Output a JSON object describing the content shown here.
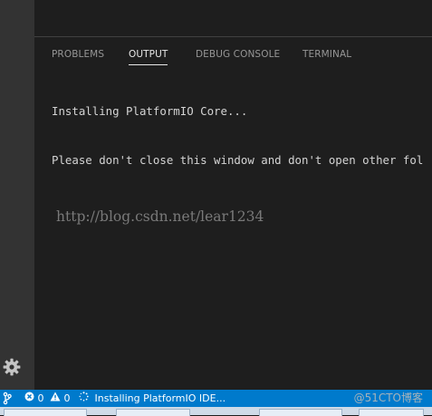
{
  "panel": {
    "tabs": [
      {
        "label": "PROBLEMS"
      },
      {
        "label": "OUTPUT"
      },
      {
        "label": "DEBUG CONSOLE"
      },
      {
        "label": "TERMINAL"
      }
    ],
    "active_tab": "OUTPUT",
    "output_lines": [
      "Installing PlatformIO Core...",
      "Please don't close this window and don't open other fol"
    ]
  },
  "watermark": {
    "text": "http://blog.csdn.net/lear1234",
    "corner_text": "@51CTO博客"
  },
  "status_bar": {
    "errors": "0",
    "warnings": "0",
    "task_text": "Installing PlatformIO IDE..."
  },
  "colors": {
    "activity_bar": "#333333",
    "editor_bg": "#1e1e1e",
    "status_bar": "#007acc",
    "active_tab": "#e7e7e7",
    "inactive_tab": "#969696"
  },
  "icons": [
    "gear-icon",
    "source-control-icon",
    "error-icon",
    "warning-icon",
    "sync-spinner-icon"
  ]
}
